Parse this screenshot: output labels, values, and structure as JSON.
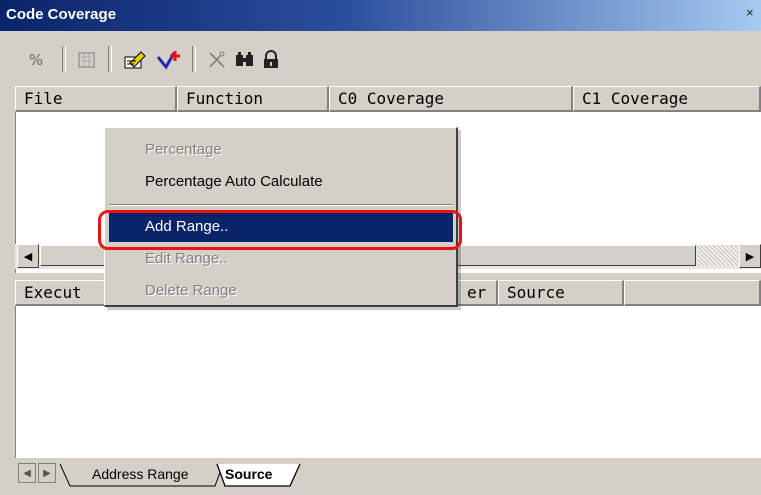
{
  "window": {
    "title": "Code Coverage",
    "close_glyph": "×"
  },
  "toolbar": {
    "percent_label": "%",
    "icons": [
      "auto-calculate-icon",
      "add-range-icon",
      "add-range-plus-icon",
      "clear-icon",
      "find-icon",
      "lock-icon"
    ]
  },
  "top_table": {
    "columns": [
      "File",
      "Function",
      "C0 Coverage",
      "C1 Coverage"
    ]
  },
  "bottom_table": {
    "columns_visible": [
      "Execut",
      "er",
      "Source"
    ]
  },
  "tabs": [
    {
      "label": "Address Range",
      "active": false
    },
    {
      "label": "Source",
      "active": true
    }
  ],
  "context_menu": {
    "items": [
      {
        "label": "Percentage",
        "enabled": false
      },
      {
        "label": "Percentage Auto Calculate",
        "enabled": true
      },
      {
        "label": "Add Range..",
        "enabled": true,
        "highlighted": true
      },
      {
        "label": "Edit Range..",
        "enabled": false
      },
      {
        "label": "Delete Range",
        "enabled": false
      }
    ]
  },
  "colors": {
    "highlight": "#0a246a",
    "callout_ring": "#e11111",
    "titlebar": "#0a246a"
  }
}
